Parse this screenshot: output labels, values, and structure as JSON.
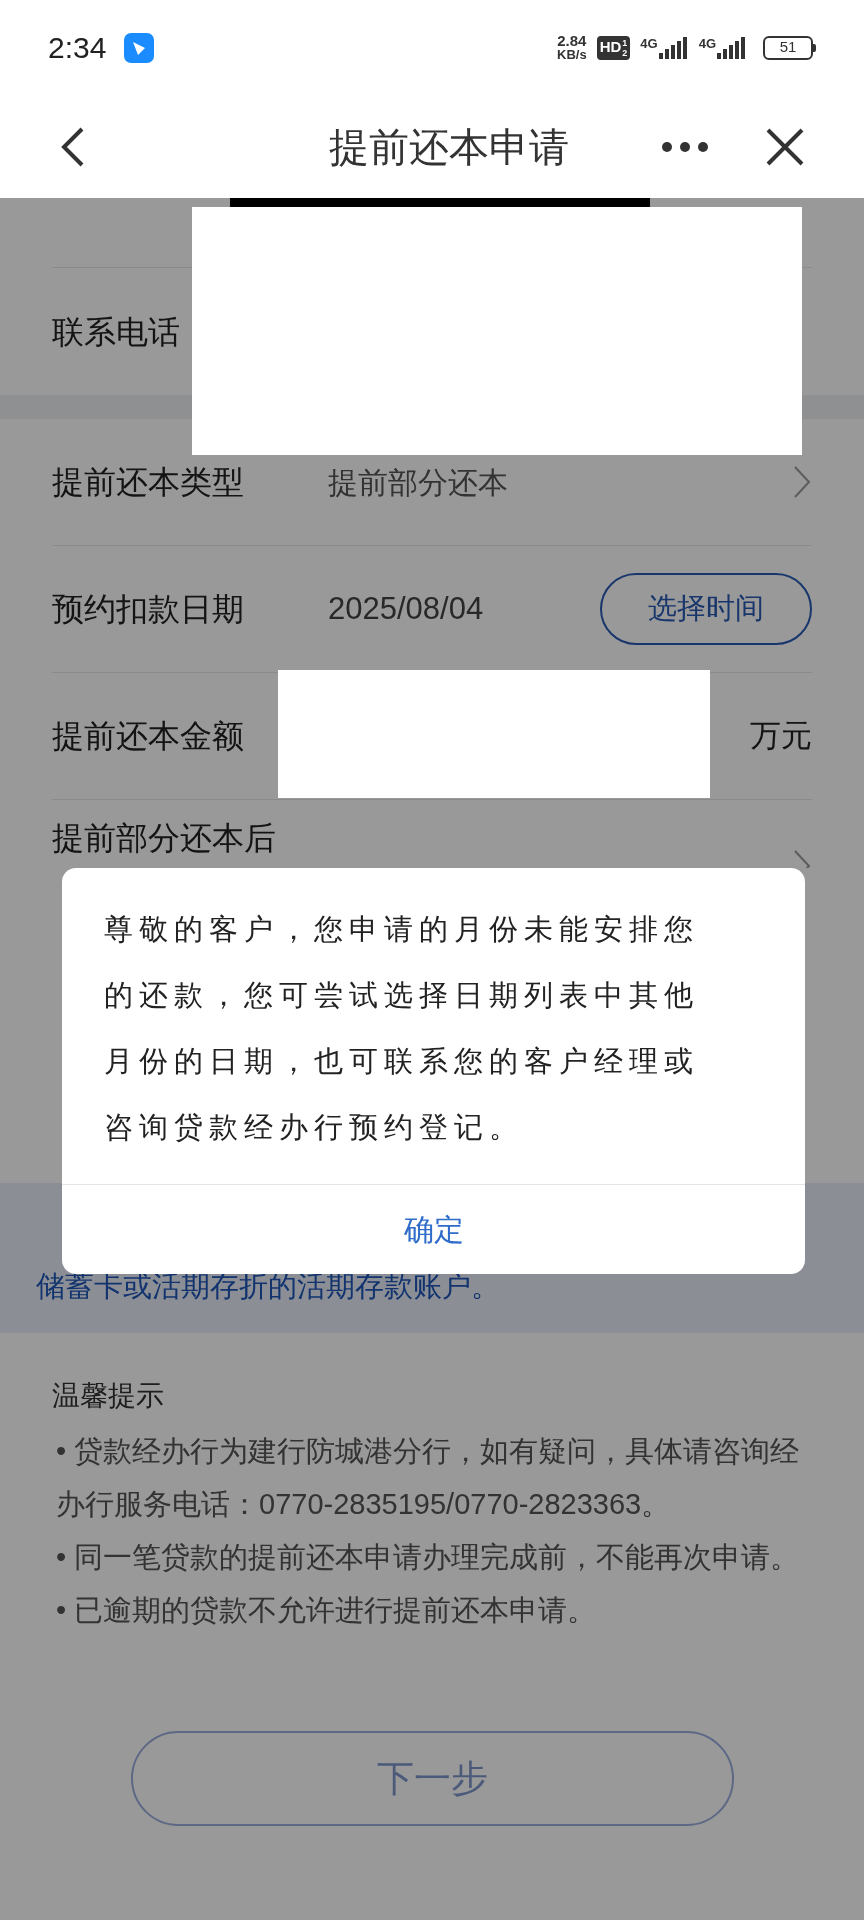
{
  "status_bar": {
    "time": "2:34",
    "speed_value": "2.84",
    "speed_unit": "KB/s",
    "hd_badge": "HD",
    "hd_sims": [
      "1",
      "2"
    ],
    "networks": [
      "4G",
      "4G"
    ],
    "battery": "51"
  },
  "header": {
    "title": "提前还本申请"
  },
  "sections": [
    {
      "rows": [
        {
          "kind": "text",
          "label": "联系电话"
        }
      ]
    },
    {
      "rows": [
        {
          "kind": "select",
          "label": "提前还本类型",
          "value": "提前部分还本"
        },
        {
          "kind": "date",
          "label": "预约扣款日期",
          "value": "2025/08/04",
          "action": "选择时间"
        },
        {
          "kind": "amount",
          "label": "提前还本金额",
          "unit": "万元"
        },
        {
          "kind": "option",
          "label": "提前部分还本后"
        }
      ]
    }
  ],
  "notice": "储蓄卡或活期存折的活期存款账户。",
  "tips": {
    "title": "温馨提示",
    "items": [
      "•  贷款经办行为建行防城港分行，如有疑问，具体请咨询经办行服务电话：0770-2835195/0770-2823363。",
      "•  同一笔贷款的提前还本申请办理完成前，不能再次申请。",
      "•  已逾期的贷款不允许进行提前还本申请。"
    ]
  },
  "next_button": "下一步",
  "dialog": {
    "message": "尊敬的客户，您申请的月份未能安排您的还款，您可尝试选择日期列表中其他月份的日期，也可联系您的客户经理或咨询贷款经办行预约登记。",
    "confirm": "确定"
  }
}
